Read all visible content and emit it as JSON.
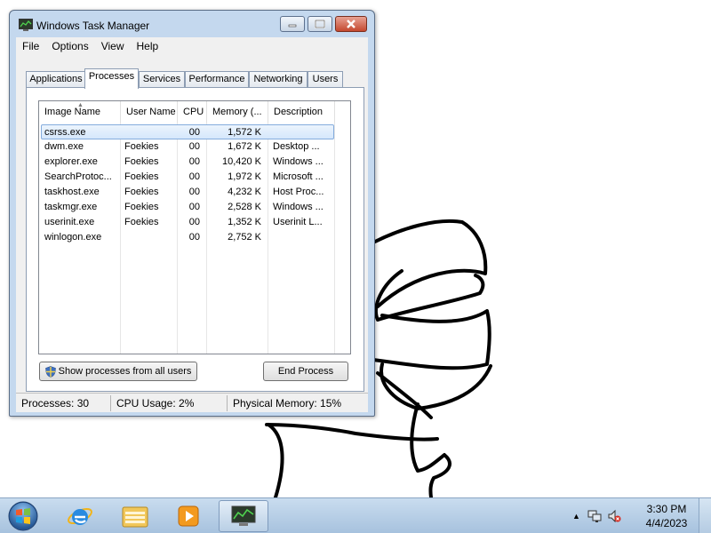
{
  "window": {
    "title": "Windows Task Manager",
    "menu": [
      "File",
      "Options",
      "View",
      "Help"
    ],
    "tabs": [
      "Applications",
      "Processes",
      "Services",
      "Performance",
      "Networking",
      "Users"
    ],
    "active_tab": "Processes"
  },
  "process_table": {
    "columns": [
      "Image Name",
      "User Name",
      "CPU",
      "Memory (...",
      "Description"
    ],
    "rows": [
      {
        "image": "csrss.exe",
        "user": "",
        "cpu": "00",
        "memory": "1,572 K",
        "description": ""
      },
      {
        "image": "dwm.exe",
        "user": "Foekies",
        "cpu": "00",
        "memory": "1,672 K",
        "description": "Desktop ..."
      },
      {
        "image": "explorer.exe",
        "user": "Foekies",
        "cpu": "00",
        "memory": "10,420 K",
        "description": "Windows ..."
      },
      {
        "image": "SearchProtoc...",
        "user": "Foekies",
        "cpu": "00",
        "memory": "1,972 K",
        "description": "Microsoft ..."
      },
      {
        "image": "taskhost.exe",
        "user": "Foekies",
        "cpu": "00",
        "memory": "4,232 K",
        "description": "Host Proc..."
      },
      {
        "image": "taskmgr.exe",
        "user": "Foekies",
        "cpu": "00",
        "memory": "2,528 K",
        "description": "Windows ..."
      },
      {
        "image": "userinit.exe",
        "user": "Foekies",
        "cpu": "00",
        "memory": "1,352 K",
        "description": "Userinit L..."
      },
      {
        "image": "winlogon.exe",
        "user": "",
        "cpu": "00",
        "memory": "2,752 K",
        "description": ""
      }
    ],
    "selected_row": 0
  },
  "buttons": {
    "show_all": "Show processes from all users",
    "end_process": "End Process"
  },
  "status": {
    "processes": "Processes: 30",
    "cpu": "CPU Usage: 2%",
    "memory": "Physical Memory: 15%"
  },
  "taskbar": {
    "apps": [
      "start-orb-icon",
      "internet-explorer-icon",
      "file-explorer-icon",
      "media-player-icon",
      "task-manager-icon"
    ],
    "time": "3:30 PM",
    "date": "4/4/2023"
  },
  "colors": {
    "selection": "#d5e7fb",
    "close_button": "#c4482f",
    "taskbar": "#b9cfe5"
  }
}
